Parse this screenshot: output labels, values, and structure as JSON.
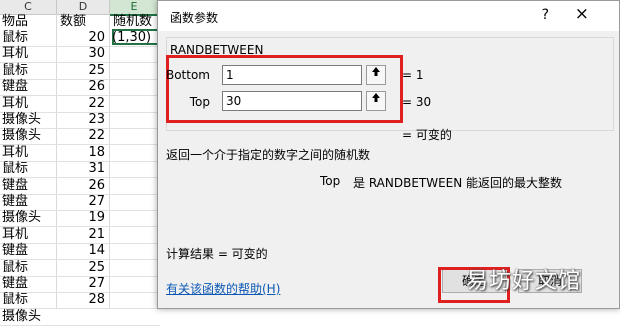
{
  "sheet": {
    "columns": [
      "C",
      "D",
      "E"
    ],
    "header_row": {
      "item": "物品",
      "amount": "数额",
      "random": "随机数"
    },
    "active_cell_formula": "(1,30)",
    "rows": [
      {
        "item": "鼠标",
        "amount": "20"
      },
      {
        "item": "耳机",
        "amount": "30"
      },
      {
        "item": "鼠标",
        "amount": "25"
      },
      {
        "item": "键盘",
        "amount": "26"
      },
      {
        "item": "耳机",
        "amount": "22"
      },
      {
        "item": "摄像头",
        "amount": "23"
      },
      {
        "item": "摄像头",
        "amount": "22"
      },
      {
        "item": "耳机",
        "amount": "18"
      },
      {
        "item": "鼠标",
        "amount": "31"
      },
      {
        "item": "键盘",
        "amount": "26"
      },
      {
        "item": "键盘",
        "amount": "27"
      },
      {
        "item": "摄像头",
        "amount": "19"
      },
      {
        "item": "耳机",
        "amount": "21"
      },
      {
        "item": "键盘",
        "amount": "14"
      },
      {
        "item": "鼠标",
        "amount": "25"
      },
      {
        "item": "键盘",
        "amount": "27"
      },
      {
        "item": "鼠标",
        "amount": "28"
      },
      {
        "item": "摄像头",
        "amount": ""
      }
    ]
  },
  "dialog": {
    "title": "函数参数",
    "help_glyph": "?",
    "close_glyph": "×",
    "function_name": "RANDBETWEEN",
    "args": [
      {
        "label": "Bottom",
        "value": "1",
        "result": "=  1"
      },
      {
        "label": "Top",
        "value": "30",
        "result": "=  30"
      }
    ],
    "formula_result": "=   可变的",
    "description": "返回一个介于指定的数字之间的随机数",
    "arg_desc_name": "Top",
    "arg_desc_text": "是 RANDBETWEEN 能返回的最大整数",
    "calc_result": "计算结果 =   可变的",
    "help_link": "有关该函数的帮助(H)",
    "ok_label": "确定",
    "cancel_label": "取消",
    "watermark": "易坊好文馆"
  }
}
